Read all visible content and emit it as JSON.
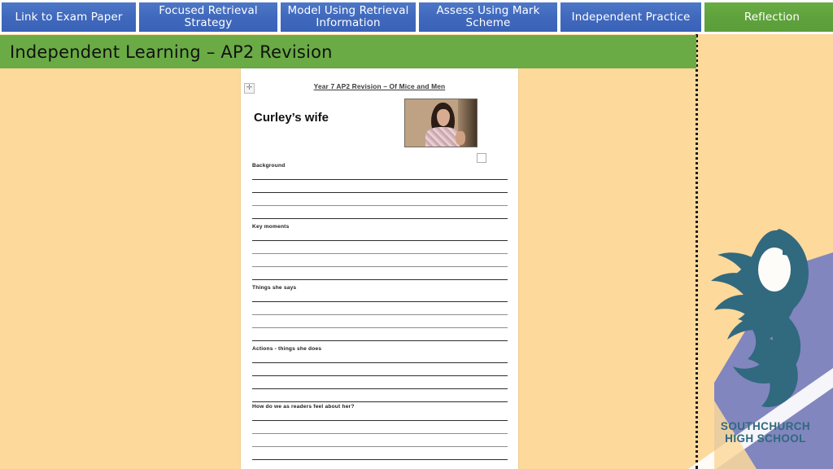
{
  "slide": {
    "background_color": "#FDD99B",
    "title": "Independent Learning – AP2 Revision",
    "title_banner_color": "#6AAB45"
  },
  "navigation": {
    "accent_blue": "#3F68BD",
    "accent_green": "#5FA23C",
    "tabs": [
      {
        "label": "Link to Exam Paper",
        "state": "blue"
      },
      {
        "label": "Focused Retrieval Strategy",
        "state": "blue"
      },
      {
        "label": "Model Using Retrieval Information",
        "state": "blue"
      },
      {
        "label": "Assess Using Mark Scheme",
        "state": "blue"
      },
      {
        "label": "Independent Practice",
        "state": "blue"
      },
      {
        "label": "Reflection",
        "state": "green"
      }
    ]
  },
  "worksheet": {
    "handle_glyph": "✛",
    "document_title": "Year 7 AP2 Revision – Of Mice and Men",
    "heading": "Curley’s wife",
    "image_alt": "curleys-wife-photo",
    "sections": [
      {
        "label": "Background",
        "lines": 4
      },
      {
        "label": "Key moments",
        "lines": 4
      },
      {
        "label": "Things she says",
        "lines": 4
      },
      {
        "label": "Actions - things she does",
        "lines": 4
      },
      {
        "label": "How do we as readers feel about her?",
        "lines": 4
      }
    ]
  },
  "logo": {
    "name_line1": "SOUTHCHURCH",
    "name_line2": "HIGH SCHOOL",
    "swan_color": "#31697F",
    "panel_color": "#8186BE",
    "text_color": "#31697F"
  }
}
